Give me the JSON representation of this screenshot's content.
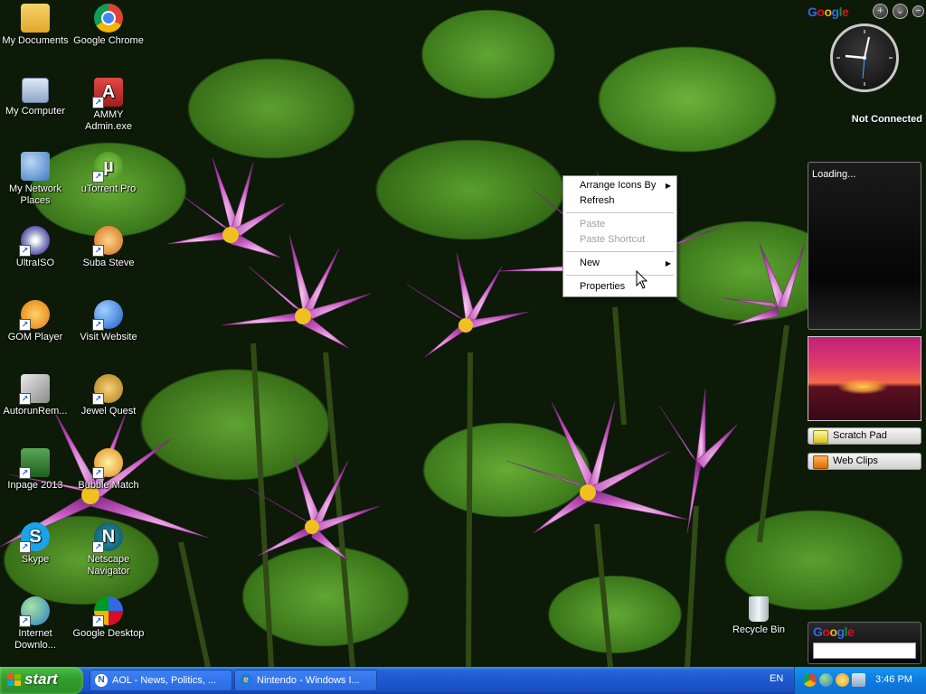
{
  "desktop": {
    "icons": [
      {
        "label": "My Documents",
        "icon": "folder-icon",
        "color": "#f2c24a"
      },
      {
        "label": "Google Chrome",
        "icon": "chrome-icon",
        "color": "#db4437"
      },
      {
        "label": "My Computer",
        "icon": "computer-icon",
        "color": "#9fb8d8"
      },
      {
        "label": "AMMY Admin.exe",
        "icon": "ammy-admin-icon",
        "color": "#c0302e"
      },
      {
        "label": "My Network Places",
        "icon": "network-icon",
        "color": "#7aa6d6"
      },
      {
        "label": "uTorrent Pro",
        "icon": "utorrent-icon",
        "color": "#6bb832"
      },
      {
        "label": "UltraISO",
        "icon": "ultraiso-icon",
        "color": "#c8c8d8"
      },
      {
        "label": "Suba Steve",
        "icon": "suba-steve-icon",
        "color": "#e07b2a"
      },
      {
        "label": "GOM Player",
        "icon": "gom-player-icon",
        "color": "#f39a1c"
      },
      {
        "label": "Visit Website",
        "icon": "globe-icon",
        "color": "#2d6fd1"
      },
      {
        "label": "AutorunRem...",
        "icon": "autorun-remover-icon",
        "color": "#d8c04a"
      },
      {
        "label": "Jewel Quest",
        "icon": "jewel-quest-icon",
        "color": "#d9a02b"
      },
      {
        "label": "Inpage 2013",
        "icon": "inpage-icon",
        "color": "#3a8a3a"
      },
      {
        "label": "Bubble Match",
        "icon": "bubble-match-icon",
        "color": "#e6a22a"
      },
      {
        "label": "Skype",
        "icon": "skype-icon",
        "color": "#1aa3e8"
      },
      {
        "label": "Netscape Navigator",
        "icon": "netscape-icon",
        "color": "#167a8a"
      },
      {
        "label": "Internet Downlo...",
        "icon": "internet-download-icon",
        "color": "#3fa64a"
      },
      {
        "label": "Google Desktop",
        "icon": "google-desktop-icon",
        "color": "#e0a020"
      },
      {
        "label": "Recycle Bin",
        "icon": "recycle-bin-icon",
        "color": "#d6dde4"
      }
    ]
  },
  "context_menu": {
    "items": [
      {
        "label": "Arrange Icons By",
        "submenu": true,
        "enabled": true
      },
      {
        "label": "Refresh",
        "submenu": false,
        "enabled": true
      },
      {
        "label": "Paste",
        "submenu": false,
        "enabled": false
      },
      {
        "label": "Paste Shortcut",
        "submenu": false,
        "enabled": false
      },
      {
        "label": "New",
        "submenu": true,
        "enabled": true
      },
      {
        "label": "Properties",
        "submenu": false,
        "enabled": true
      }
    ],
    "submenu_glyph": "▶"
  },
  "sidebar": {
    "google_logo": [
      "G",
      "o",
      "o",
      "g",
      "l",
      "e"
    ],
    "add_glyph": "+",
    "menu_glyph": "⌄",
    "minimize_glyph": "−",
    "status_text": "Not Connected",
    "news_loading": "Loading...",
    "scratch_pad_label": "Scratch Pad",
    "web_clips_label": "Web Clips",
    "search_value": ""
  },
  "taskbar": {
    "start_label": "start",
    "tasks": [
      {
        "label": "AOL - News, Politics, ...",
        "icon": "aol-icon"
      },
      {
        "label": "Nintendo - Windows I...",
        "icon": "internet-explorer-icon"
      }
    ],
    "language": "EN",
    "clock": "3:46 PM"
  },
  "colors": {
    "google": [
      "#3369e8",
      "#d50f25",
      "#eeb211",
      "#3369e8",
      "#009925",
      "#d50f25"
    ],
    "taskbar": "#2566d8",
    "start": "#2f9e2b"
  }
}
